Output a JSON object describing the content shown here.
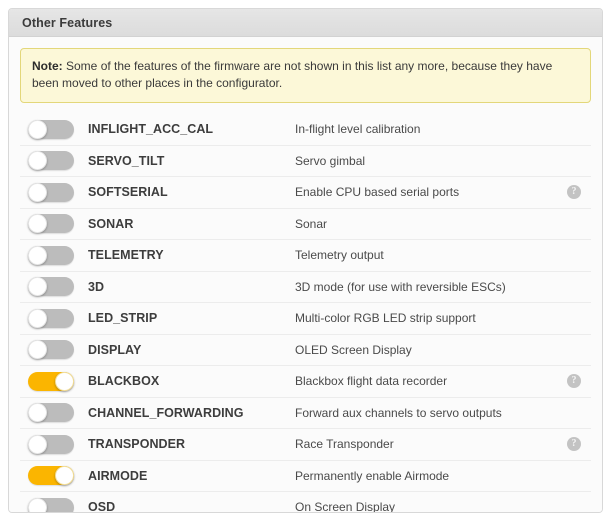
{
  "panel": {
    "title": "Other Features"
  },
  "note": {
    "label": "Note:",
    "text": " Some of the features of the firmware are not shown in this list any more, because they have been moved to other places in the configurator."
  },
  "help_icon_glyph": "?",
  "colors": {
    "toggle_on": "#fbb500",
    "toggle_off": "#bcbcbc",
    "note_background": "#fcf8d8",
    "note_border": "#e3d77a",
    "header_background": "#e0e0e0",
    "panel_background": "#fbfbfb",
    "row_divider": "#ececec"
  },
  "features": [
    {
      "name": "INFLIGHT_ACC_CAL",
      "description": "In-flight level calibration",
      "enabled": false,
      "help": false
    },
    {
      "name": "SERVO_TILT",
      "description": "Servo gimbal",
      "enabled": false,
      "help": false
    },
    {
      "name": "SOFTSERIAL",
      "description": "Enable CPU based serial ports",
      "enabled": false,
      "help": true
    },
    {
      "name": "SONAR",
      "description": "Sonar",
      "enabled": false,
      "help": false
    },
    {
      "name": "TELEMETRY",
      "description": "Telemetry output",
      "enabled": false,
      "help": false
    },
    {
      "name": "3D",
      "description": "3D mode (for use with reversible ESCs)",
      "enabled": false,
      "help": false
    },
    {
      "name": "LED_STRIP",
      "description": "Multi-color RGB LED strip support",
      "enabled": false,
      "help": false
    },
    {
      "name": "DISPLAY",
      "description": "OLED Screen Display",
      "enabled": false,
      "help": false
    },
    {
      "name": "BLACKBOX",
      "description": "Blackbox flight data recorder",
      "enabled": true,
      "help": true
    },
    {
      "name": "CHANNEL_FORWARDING",
      "description": "Forward aux channels to servo outputs",
      "enabled": false,
      "help": false
    },
    {
      "name": "TRANSPONDER",
      "description": "Race Transponder",
      "enabled": false,
      "help": true
    },
    {
      "name": "AIRMODE",
      "description": "Permanently enable Airmode",
      "enabled": true,
      "help": false
    },
    {
      "name": "OSD",
      "description": "On Screen Display",
      "enabled": false,
      "help": false
    }
  ]
}
